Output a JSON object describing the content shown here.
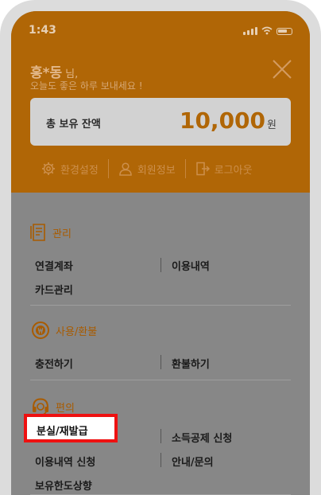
{
  "status": {
    "time": "1:43"
  },
  "greeting": {
    "name": "홍*동",
    "suffix": "님,",
    "message": "오늘도 좋은 하루 보내세요 !"
  },
  "balance": {
    "label": "총 보유 잔액",
    "amount": "10,000",
    "unit": "원"
  },
  "quick_links": [
    {
      "label": "환경설정",
      "icon": "gear-icon"
    },
    {
      "label": "회원정보",
      "icon": "user-icon"
    },
    {
      "label": "로그아웃",
      "icon": "logout-icon"
    }
  ],
  "sections": [
    {
      "title": "관리",
      "icon": "receipt-icon",
      "items": [
        "연결계좌",
        "이용내역",
        "카드관리"
      ]
    },
    {
      "title": "사용/환불",
      "icon": "won-refresh-icon",
      "items": [
        "충전하기",
        "환불하기"
      ]
    },
    {
      "title": "편의",
      "icon": "headset-icon",
      "items": [
        "분실/재발급",
        "소득공제 신청",
        "이용내역 신청",
        "안내/문의",
        "보유한도상향"
      ]
    }
  ],
  "colors": {
    "accent": "#b06606",
    "highlight": "#ee1111"
  }
}
